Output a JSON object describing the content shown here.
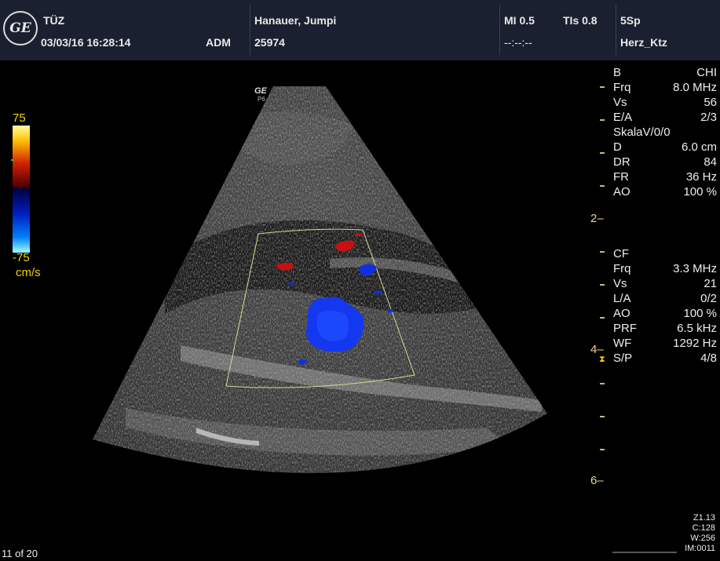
{
  "header": {
    "institution": "TÜZ",
    "datetime": "03/03/16 16:28:14",
    "operator": "ADM",
    "patient_name": "Hanauer, Jumpi",
    "patient_id": "25974",
    "mi": "MI 0.5",
    "tis": "TIs 0.8",
    "probe": "5Sp",
    "preset": "Herz_Ktz",
    "time_field": "--:--:--",
    "logo_text": "GE"
  },
  "probe_marker": {
    "logo": "GE",
    "label": "P6"
  },
  "color_scale": {
    "top": "75",
    "bottom": "-75",
    "unit": "cm/s"
  },
  "bmode_params": [
    {
      "k": "B",
      "v": "CHI"
    },
    {
      "k": "Frq",
      "v": "8.0 MHz"
    },
    {
      "k": "Vs",
      "v": "56"
    },
    {
      "k": "E/A",
      "v": "2/3"
    },
    {
      "k": "SkalaV/0/0",
      "v": ""
    },
    {
      "k": "D",
      "v": "6.0 cm"
    },
    {
      "k": "DR",
      "v": "84"
    },
    {
      "k": "FR",
      "v": "36 Hz"
    },
    {
      "k": "AO",
      "v": "100 %"
    }
  ],
  "cf_params": [
    {
      "k": "CF",
      "v": ""
    },
    {
      "k": "Frq",
      "v": "3.3 MHz"
    },
    {
      "k": "Vs",
      "v": "21"
    },
    {
      "k": "L/A",
      "v": "0/2"
    },
    {
      "k": "AO",
      "v": "100 %"
    },
    {
      "k": "PRF",
      "v": "6.5 kHz"
    },
    {
      "k": "WF",
      "v": "1292 Hz"
    },
    {
      "k": "S/P",
      "v": "4/8"
    }
  ],
  "depth_marks": [
    "2",
    "4",
    "6"
  ],
  "footer": {
    "frame": "11 of 20",
    "zoom": "Z1.13",
    "c": "C:128",
    "w": "W:256",
    "im": "IM:0011"
  },
  "colors": {
    "header_bg": "#1b2030",
    "scale_label": "#f2d000",
    "roi_box": "#d8d890",
    "flow_red": "#c81010",
    "flow_blue": "#1030e0"
  }
}
